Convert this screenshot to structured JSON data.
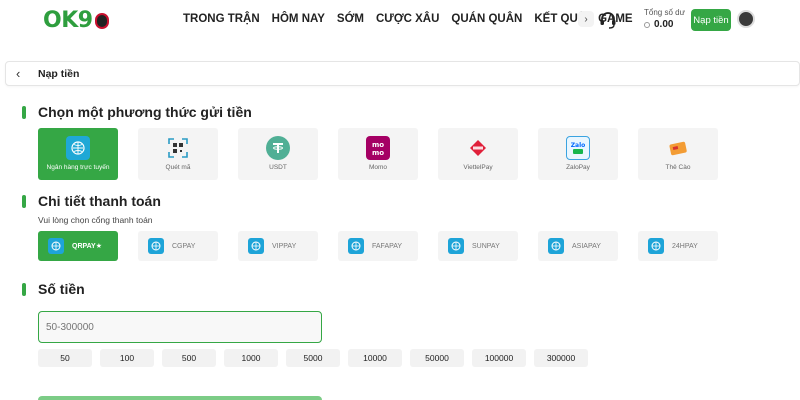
{
  "header": {
    "logo_text": "OK9",
    "nav": [
      "TRONG TRẬN",
      "HÔM NAY",
      "SỚM",
      "CƯỢC XÂU",
      "QUÁN QUÂN",
      "KẾT QUẢ",
      "GAME"
    ],
    "nav_more_icon": "chevron-right-icon",
    "support_icon": "headset-icon",
    "balance_label": "Tổng số dư",
    "balance_value": "0.00",
    "deposit_label": "Nạp tiền",
    "accent_color": "#35a745"
  },
  "subbar": {
    "back_icon": "chevron-left-icon",
    "title": "Nạp tiền"
  },
  "methods": {
    "title": "Chọn một phương thức gửi tiền",
    "items": [
      {
        "label": "Ngân hàng trực tuyến",
        "icon": "online-bank-icon",
        "active": true
      },
      {
        "label": "Quét mã",
        "icon": "qr-scan-icon",
        "active": false
      },
      {
        "label": "USDT",
        "icon": "tether-icon",
        "active": false
      },
      {
        "label": "Momo",
        "icon": "momo-icon",
        "active": false
      },
      {
        "label": "ViettelPay",
        "icon": "viettelpay-icon",
        "active": false
      },
      {
        "label": "ZaloPay",
        "icon": "zalopay-icon",
        "active": false
      },
      {
        "label": "Thẻ Cào",
        "icon": "scratch-card-icon",
        "active": false
      }
    ]
  },
  "payment": {
    "title": "Chi tiết thanh toán",
    "note": "Vui lòng chọn cổng thanh toán",
    "gates": [
      {
        "label": "QRPAY★",
        "active": true
      },
      {
        "label": "CGPAY",
        "active": false
      },
      {
        "label": "VIPPAY",
        "active": false
      },
      {
        "label": "FAFAPAY",
        "active": false
      },
      {
        "label": "SUNPAY",
        "active": false
      },
      {
        "label": "ASIAPAY",
        "active": false
      },
      {
        "label": "24HPAY",
        "active": false
      }
    ]
  },
  "amount": {
    "title": "Số tiền",
    "placeholder": "50-300000",
    "quick_values": [
      "50",
      "100",
      "500",
      "1000",
      "5000",
      "10000",
      "50000",
      "100000",
      "300000"
    ]
  }
}
